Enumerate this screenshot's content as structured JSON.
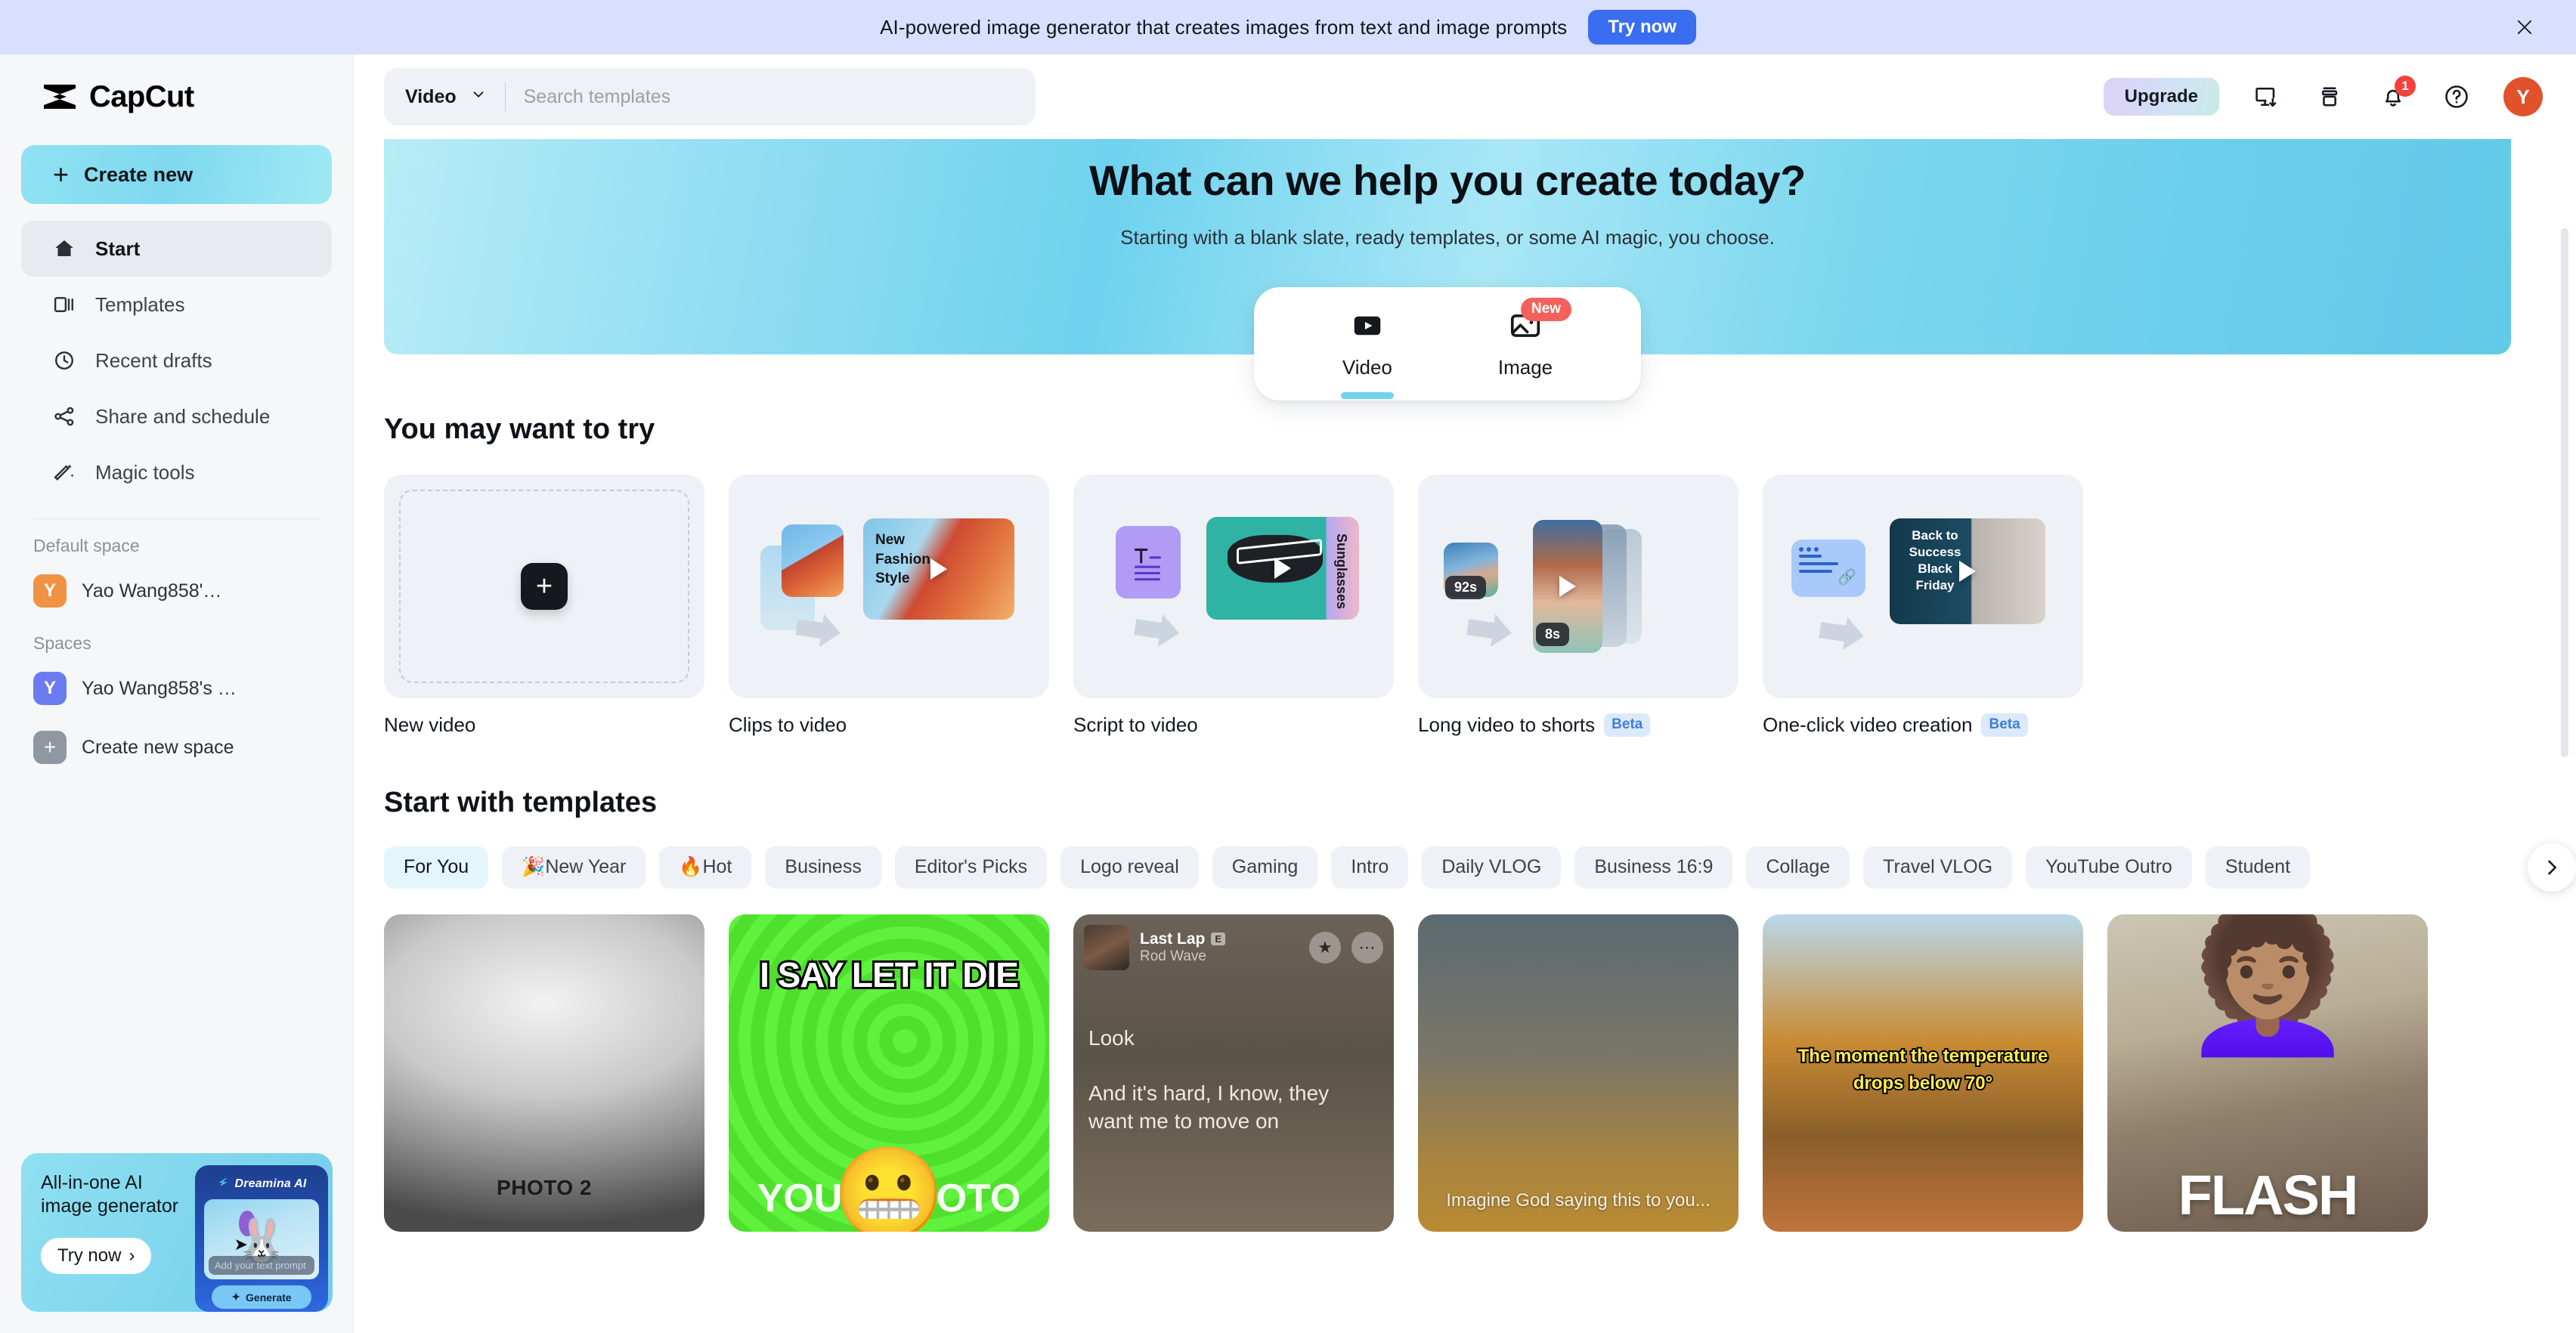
{
  "banner": {
    "text": "AI-powered image generator that creates images from text and image prompts",
    "cta": "Try now",
    "close_icon": "close-icon",
    "bg_color": "#d8e0fd",
    "cta_color": "#3a6df0"
  },
  "sidebar": {
    "brand": "CapCut",
    "create_new": "Create new",
    "nav": [
      {
        "label": "Start",
        "icon": "home-icon",
        "active": true
      },
      {
        "label": "Templates",
        "icon": "templates-icon",
        "active": false
      },
      {
        "label": "Recent drafts",
        "icon": "clock-icon",
        "active": false
      },
      {
        "label": "Share and schedule",
        "icon": "share-icon",
        "active": false
      },
      {
        "label": "Magic tools",
        "icon": "magic-wand-icon",
        "active": false
      }
    ],
    "default_space_label": "Default space",
    "default_space": {
      "name": "Yao Wang858'…",
      "avatar_letter": "Y",
      "avatar_color": "#f09244"
    },
    "spaces_label": "Spaces",
    "spaces": [
      {
        "name": "Yao Wang858's …",
        "avatar_letter": "Y",
        "avatar_color": "#6b7cf0"
      }
    ],
    "create_new_space": "Create new space",
    "promo": {
      "title": "All-in-one AI image generator",
      "cta": "Try now",
      "brand": "Dreamina AI",
      "prompt_placeholder": "Add your text prompt",
      "generate_label": "Generate"
    }
  },
  "topbar": {
    "search_category": "Video",
    "search_placeholder": "Search templates",
    "upgrade_label": "Upgrade",
    "icons": [
      {
        "name": "download-desktop-icon"
      },
      {
        "name": "archive-box-icon"
      },
      {
        "name": "notifications-bell-icon",
        "badge": "1"
      },
      {
        "name": "help-circle-icon"
      }
    ],
    "avatar_letter": "Y",
    "avatar_color": "#e2522a"
  },
  "hero": {
    "title": "What can we help you create today?",
    "subtitle": "Starting with a blank slate, ready templates, or some AI magic, you choose.",
    "modes": [
      {
        "label": "Video",
        "icon": "video-play-icon",
        "active": true,
        "badge": ""
      },
      {
        "label": "Image",
        "icon": "image-icon",
        "active": false,
        "badge": "New"
      }
    ]
  },
  "try_section": {
    "title": "You may want to try",
    "cards": [
      {
        "label": "New video",
        "badge": "",
        "art": "new-video"
      },
      {
        "label": "Clips to video",
        "badge": "",
        "art": "clips-to-video",
        "art_text": "New Fashion Style"
      },
      {
        "label": "Script to video",
        "badge": "",
        "art": "script-to-video",
        "art_text": "Sunglasses"
      },
      {
        "label": "Long video to shorts",
        "badge": "Beta",
        "art": "long-to-shorts",
        "chip_a": "92s",
        "chip_b": "8s"
      },
      {
        "label": "One-click video creation",
        "badge": "Beta",
        "art": "one-click",
        "art_text": "Back to Success Black Friday"
      }
    ]
  },
  "templates_section": {
    "title": "Start with templates",
    "chips": [
      {
        "label": "For You",
        "active": true
      },
      {
        "label": "🎉New Year",
        "active": false
      },
      {
        "label": "🔥Hot",
        "active": false
      },
      {
        "label": "Business",
        "active": false
      },
      {
        "label": "Editor's Picks",
        "active": false
      },
      {
        "label": "Logo reveal",
        "active": false
      },
      {
        "label": "Gaming",
        "active": false
      },
      {
        "label": "Intro",
        "active": false
      },
      {
        "label": "Daily VLOG",
        "active": false
      },
      {
        "label": "Business 16:9",
        "active": false
      },
      {
        "label": "Collage",
        "active": false
      },
      {
        "label": "Travel VLOG",
        "active": false
      },
      {
        "label": "YouTube Outro",
        "active": false
      },
      {
        "label": "Student",
        "active": false
      }
    ],
    "next_icon": "chevron-right-icon",
    "items": [
      {
        "overlay_text": "PHOTO 2",
        "kind": "photo2"
      },
      {
        "overlay_text": "I SAY LET IT DIE",
        "secondary_text": "YOUR PHOTO",
        "kind": "green-meme"
      },
      {
        "overlay_text": "Look",
        "secondary_text": "And it's hard, I know, they want me to move on",
        "song_title": "Last Lap",
        "song_artist": "Rod Wave",
        "song_rating": "E",
        "kind": "lyrics"
      },
      {
        "overlay_text": "Imagine God saying this to you...",
        "kind": "sunset"
      },
      {
        "overlay_text": "The moment the temperature drops below 70°",
        "kind": "autumn"
      },
      {
        "overlay_text": "FLASH",
        "kind": "flash"
      }
    ]
  }
}
